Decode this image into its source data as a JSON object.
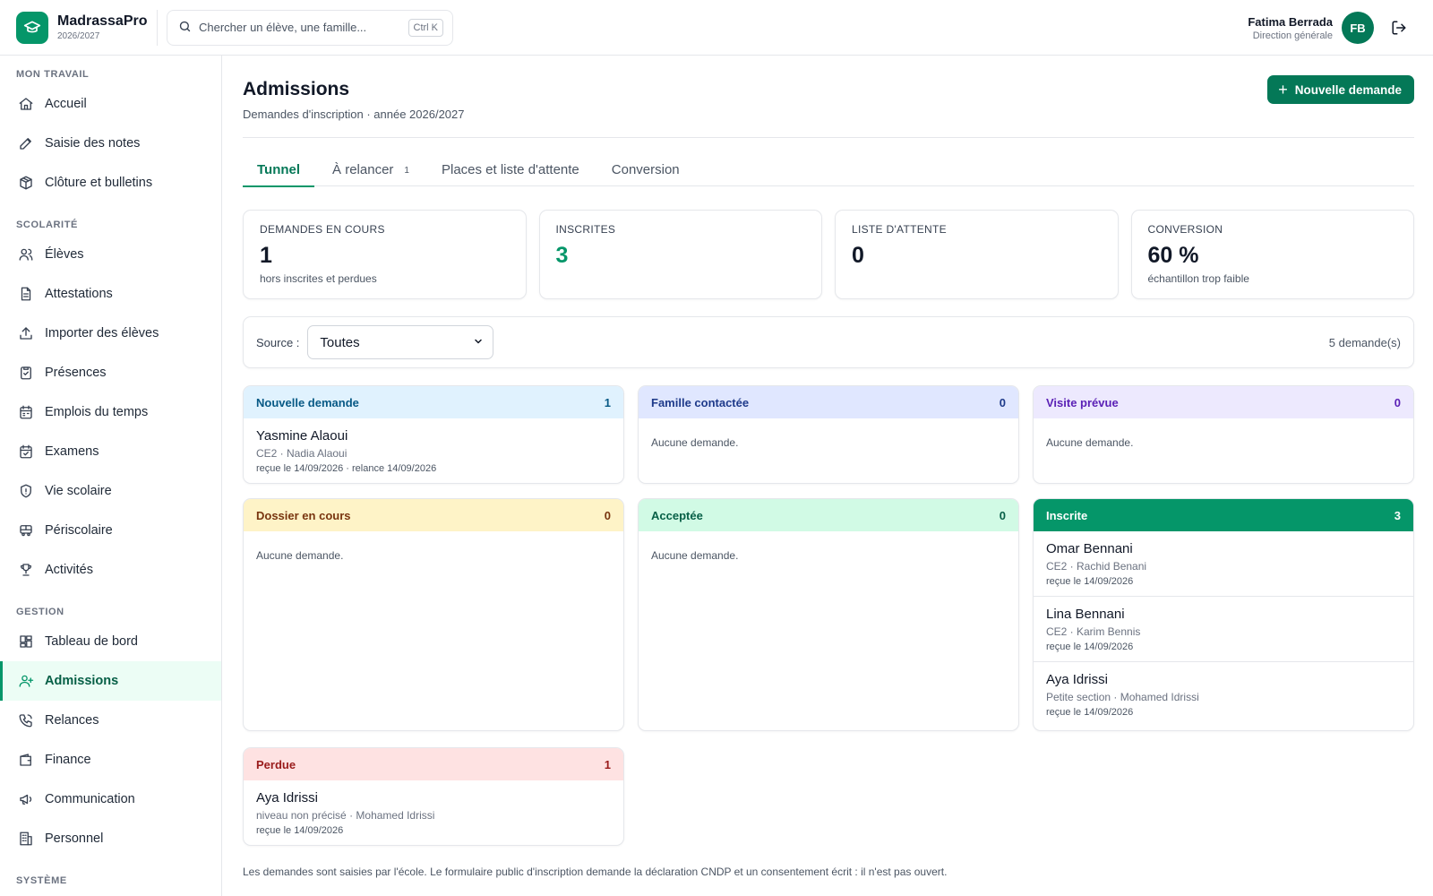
{
  "app": {
    "name": "MadrassaPro",
    "year": "2026/2027"
  },
  "search": {
    "placeholder": "Chercher un élève, une famille...",
    "shortcut": "Ctrl K"
  },
  "user": {
    "name": "Fatima Berrada",
    "role": "Direction générale",
    "initials": "FB"
  },
  "sidebar": {
    "sections": [
      {
        "label": "MON TRAVAIL",
        "items": [
          {
            "label": "Accueil",
            "icon": "home-icon"
          },
          {
            "label": "Saisie des notes",
            "icon": "pencil-icon"
          },
          {
            "label": "Clôture et bulletins",
            "icon": "package-icon"
          }
        ]
      },
      {
        "label": "SCOLARITÉ",
        "items": [
          {
            "label": "Élèves",
            "icon": "users-icon"
          },
          {
            "label": "Attestations",
            "icon": "document-icon"
          },
          {
            "label": "Importer des élèves",
            "icon": "upload-icon"
          },
          {
            "label": "Présences",
            "icon": "clipboard-check-icon"
          },
          {
            "label": "Emplois du temps",
            "icon": "calendar-icon"
          },
          {
            "label": "Examens",
            "icon": "calendar-check-icon"
          },
          {
            "label": "Vie scolaire",
            "icon": "shield-icon"
          },
          {
            "label": "Périscolaire",
            "icon": "bus-icon"
          },
          {
            "label": "Activités",
            "icon": "trophy-icon"
          }
        ]
      },
      {
        "label": "GESTION",
        "items": [
          {
            "label": "Tableau de bord",
            "icon": "dashboard-icon"
          },
          {
            "label": "Admissions",
            "icon": "user-plus-icon",
            "active": true
          },
          {
            "label": "Relances",
            "icon": "phone-icon"
          },
          {
            "label": "Finance",
            "icon": "wallet-icon"
          },
          {
            "label": "Communication",
            "icon": "megaphone-icon"
          },
          {
            "label": "Personnel",
            "icon": "building-icon"
          }
        ]
      },
      {
        "label": "SYSTÈME",
        "items": []
      }
    ]
  },
  "page": {
    "title": "Admissions",
    "subtitle": "Demandes d'inscription · année 2026/2027",
    "new_button": "Nouvelle demande"
  },
  "tabs": [
    {
      "label": "Tunnel",
      "active": true,
      "badge": ""
    },
    {
      "label": "À relancer",
      "active": false,
      "badge": "1"
    },
    {
      "label": "Places et liste d'attente",
      "active": false,
      "badge": ""
    },
    {
      "label": "Conversion",
      "active": false,
      "badge": ""
    }
  ],
  "kpis": [
    {
      "label": "DEMANDES EN COURS",
      "value": "1",
      "note": "hors inscrites et perdues",
      "accent": false
    },
    {
      "label": "INSCRITES",
      "value": "3",
      "note": "",
      "accent": true
    },
    {
      "label": "LISTE D'ATTENTE",
      "value": "0",
      "note": "",
      "accent": false
    },
    {
      "label": "CONVERSION",
      "value": "60 %",
      "note": "échantillon trop faible",
      "accent": false
    }
  ],
  "filter": {
    "label": "Source :",
    "selected": "Toutes",
    "count": "5 demande(s)"
  },
  "colors": {
    "accent": "#059669",
    "nouvelle_bg": "#e0f2fe",
    "nouvelle_fg": "#075985",
    "contactee_bg": "#e0e7ff",
    "contactee_fg": "#1e3a8a",
    "visite_bg": "#ede9fe",
    "visite_fg": "#5b21b6",
    "dossier_bg": "#fef3c7",
    "dossier_fg": "#78350f",
    "acceptee_bg": "#d1fae5",
    "acceptee_fg": "#065f46",
    "inscrite_bg": "#059669",
    "inscrite_fg": "#ffffff",
    "perdue_bg": "#fee2e2",
    "perdue_fg": "#991b1b"
  },
  "empty_label": "Aucune demande.",
  "columns": [
    {
      "title": "Nouvelle demande",
      "count": "1",
      "cards": [
        {
          "name": "Yasmine Alaoui",
          "meta": "CE2 · Nadia Alaoui",
          "date": "reçue le 14/09/2026 · relance 14/09/2026"
        }
      ]
    },
    {
      "title": "Famille contactée",
      "count": "0",
      "cards": []
    },
    {
      "title": "Visite prévue",
      "count": "0",
      "cards": []
    },
    {
      "title": "Dossier en cours",
      "count": "0",
      "cards": []
    },
    {
      "title": "Acceptée",
      "count": "0",
      "cards": []
    },
    {
      "title": "Inscrite",
      "count": "3",
      "cards": [
        {
          "name": "Omar Bennani",
          "meta": "CE2 · Rachid Benani",
          "date": "reçue le 14/09/2026"
        },
        {
          "name": "Lina Bennani",
          "meta": "CE2 · Karim Bennis",
          "date": "reçue le 14/09/2026"
        },
        {
          "name": "Aya Idrissi",
          "meta": "Petite section · Mohamed Idrissi",
          "date": "reçue le 14/09/2026"
        }
      ]
    },
    {
      "title": "Perdue",
      "count": "1",
      "cards": [
        {
          "name": "Aya Idrissi",
          "meta": "niveau non précisé · Mohamed Idrissi",
          "date": "reçue le 14/09/2026"
        }
      ]
    }
  ],
  "footnote": "Les demandes sont saisies par l'école. Le formulaire public d'inscription demande la déclaration CNDP et un consentement écrit : il n'est pas ouvert."
}
